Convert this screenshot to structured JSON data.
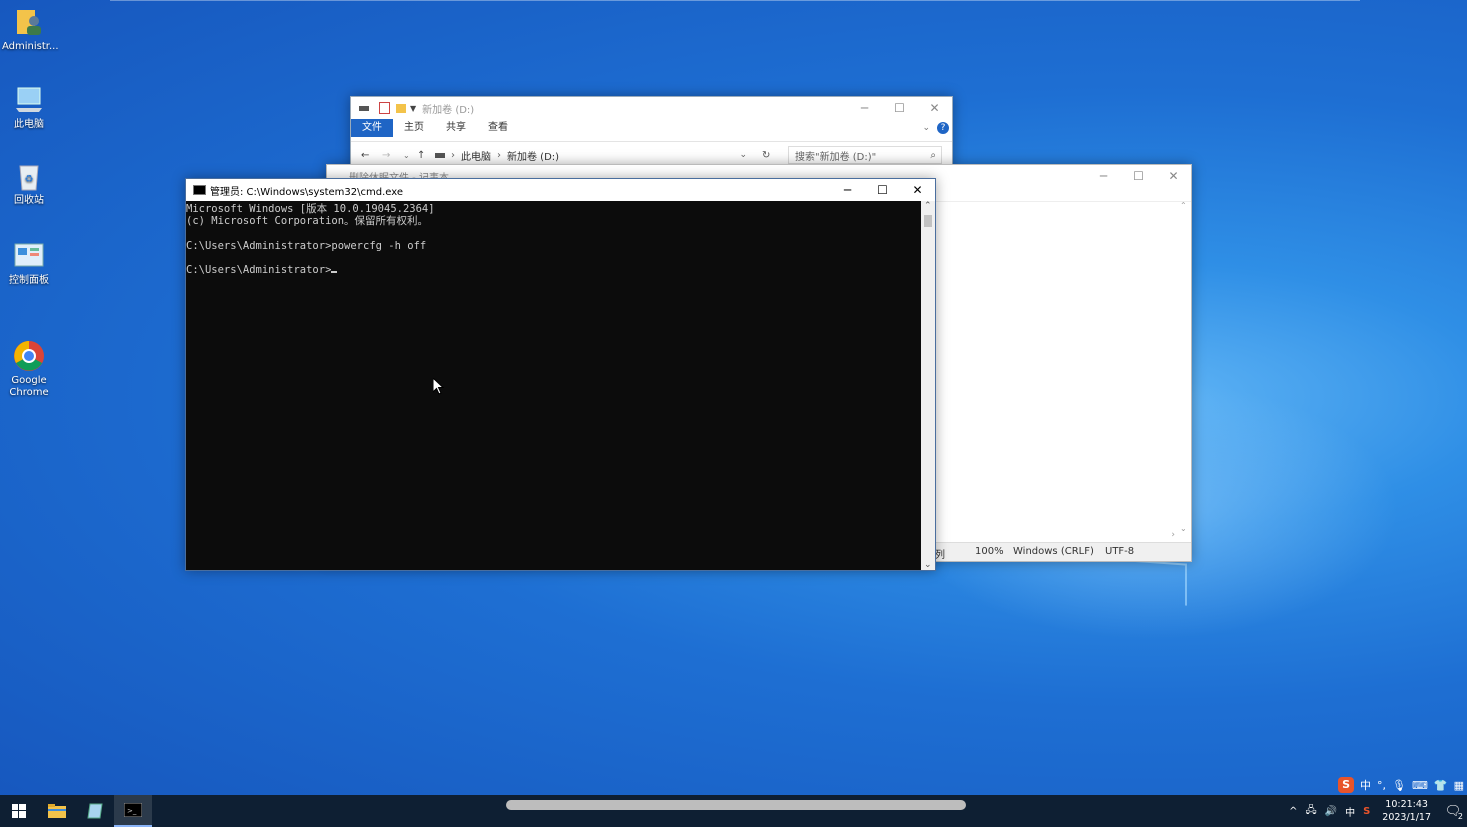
{
  "desktop": {
    "icons": [
      {
        "label": "Administr..."
      },
      {
        "label": "此电脑"
      },
      {
        "label": "回收站"
      },
      {
        "label": "控制面板"
      },
      {
        "label": "Google\nChrome"
      }
    ]
  },
  "explorer": {
    "title": "新加卷 (D:)",
    "ribbon_tabs": [
      "文件",
      "主页",
      "共享",
      "查看"
    ],
    "breadcrumb": [
      "此电脑",
      "新加卷 (D:)"
    ],
    "search_placeholder": "搜索\"新加卷 (D:)\""
  },
  "notepad": {
    "title": "删除休眠文件 - 记事本",
    "status": {
      "position": "列",
      "zoom": "100%",
      "line_ending": "Windows (CRLF)",
      "encoding": "UTF-8"
    }
  },
  "cmd": {
    "title": "管理员: C:\\Windows\\system32\\cmd.exe",
    "lines": [
      "Microsoft Windows [版本 10.0.19045.2364]",
      "(c) Microsoft Corporation。保留所有权利。",
      "",
      "C:\\Users\\Administrator>powercfg -h off",
      "",
      "C:\\Users\\Administrator>"
    ]
  },
  "taskbar": {
    "clock_time": "10:21:43",
    "clock_date": "2023/1/17",
    "ime_lang": "中",
    "notification_count": "2"
  },
  "ime_toolbar": {
    "lang": "中",
    "punct": "°,"
  },
  "colors": {
    "accent": "#1f65c5",
    "taskbar": "#0e1f33",
    "console_bg": "#0c0c0c"
  }
}
